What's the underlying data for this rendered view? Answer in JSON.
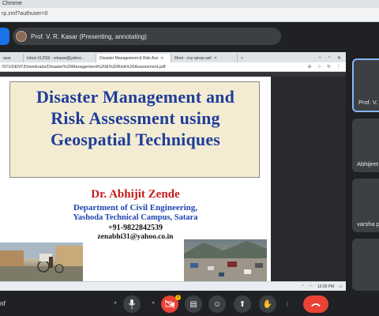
{
  "outer_browser": {
    "title_fragment": "Chrome",
    "url_fragment": "rp.zmf?authuser=0"
  },
  "meet": {
    "presenter_label": "Prof. V. R. Kasar (Presenting, annotating)",
    "meeting_code_fragment": "nf",
    "participants": [
      {
        "name": "Prof. V. R."
      },
      {
        "name": "Abhijeet"
      },
      {
        "name": "varsha p"
      },
      {
        "name": ""
      }
    ],
    "controls": {
      "mic_icon": "mic-icon",
      "camera_icon": "camera-off-icon",
      "present_icon": "present-icon",
      "raise_hand_icon": "hand-icon",
      "end_call_icon": "phone-hangup-icon",
      "unread_count": "1"
    },
    "colors": {
      "accent": "#1a73e8",
      "end_call": "#ea4335",
      "badge": "#fbbc04"
    }
  },
  "shared_window": {
    "tabs": [
      {
        "label": "Inbox (4,293) - vrkasar@yahoo...",
        "prefix": "Inbox"
      },
      {
        "label": "Disaster Management & Risk Ass",
        "active": true
      },
      {
        "label": "Meet - zny-qmxp-uwf"
      }
    ],
    "first_tab_fragment": "asar",
    "address": "/STUDENT/Downloads/Disaster%20Management%20&%20Risk%20Assessment.pdf",
    "taskbar_time": "12:09 PM"
  },
  "slide": {
    "title_lines": [
      "Disaster Management and",
      "Risk Assessment using",
      "Geospatial Techniques"
    ],
    "author": "Dr. Abhijit  Zende",
    "department": "Department of Civil Engineering,",
    "institute": "Yashoda Technical Campus, Satara",
    "phone": "+91-9822842539",
    "email": "zenabhi31@yahoo.co.in",
    "colors": {
      "title": "#1f3d99",
      "author": "#c41a1a",
      "dept": "#1f46b0",
      "title_box_bg": "#f3ecd3"
    }
  }
}
